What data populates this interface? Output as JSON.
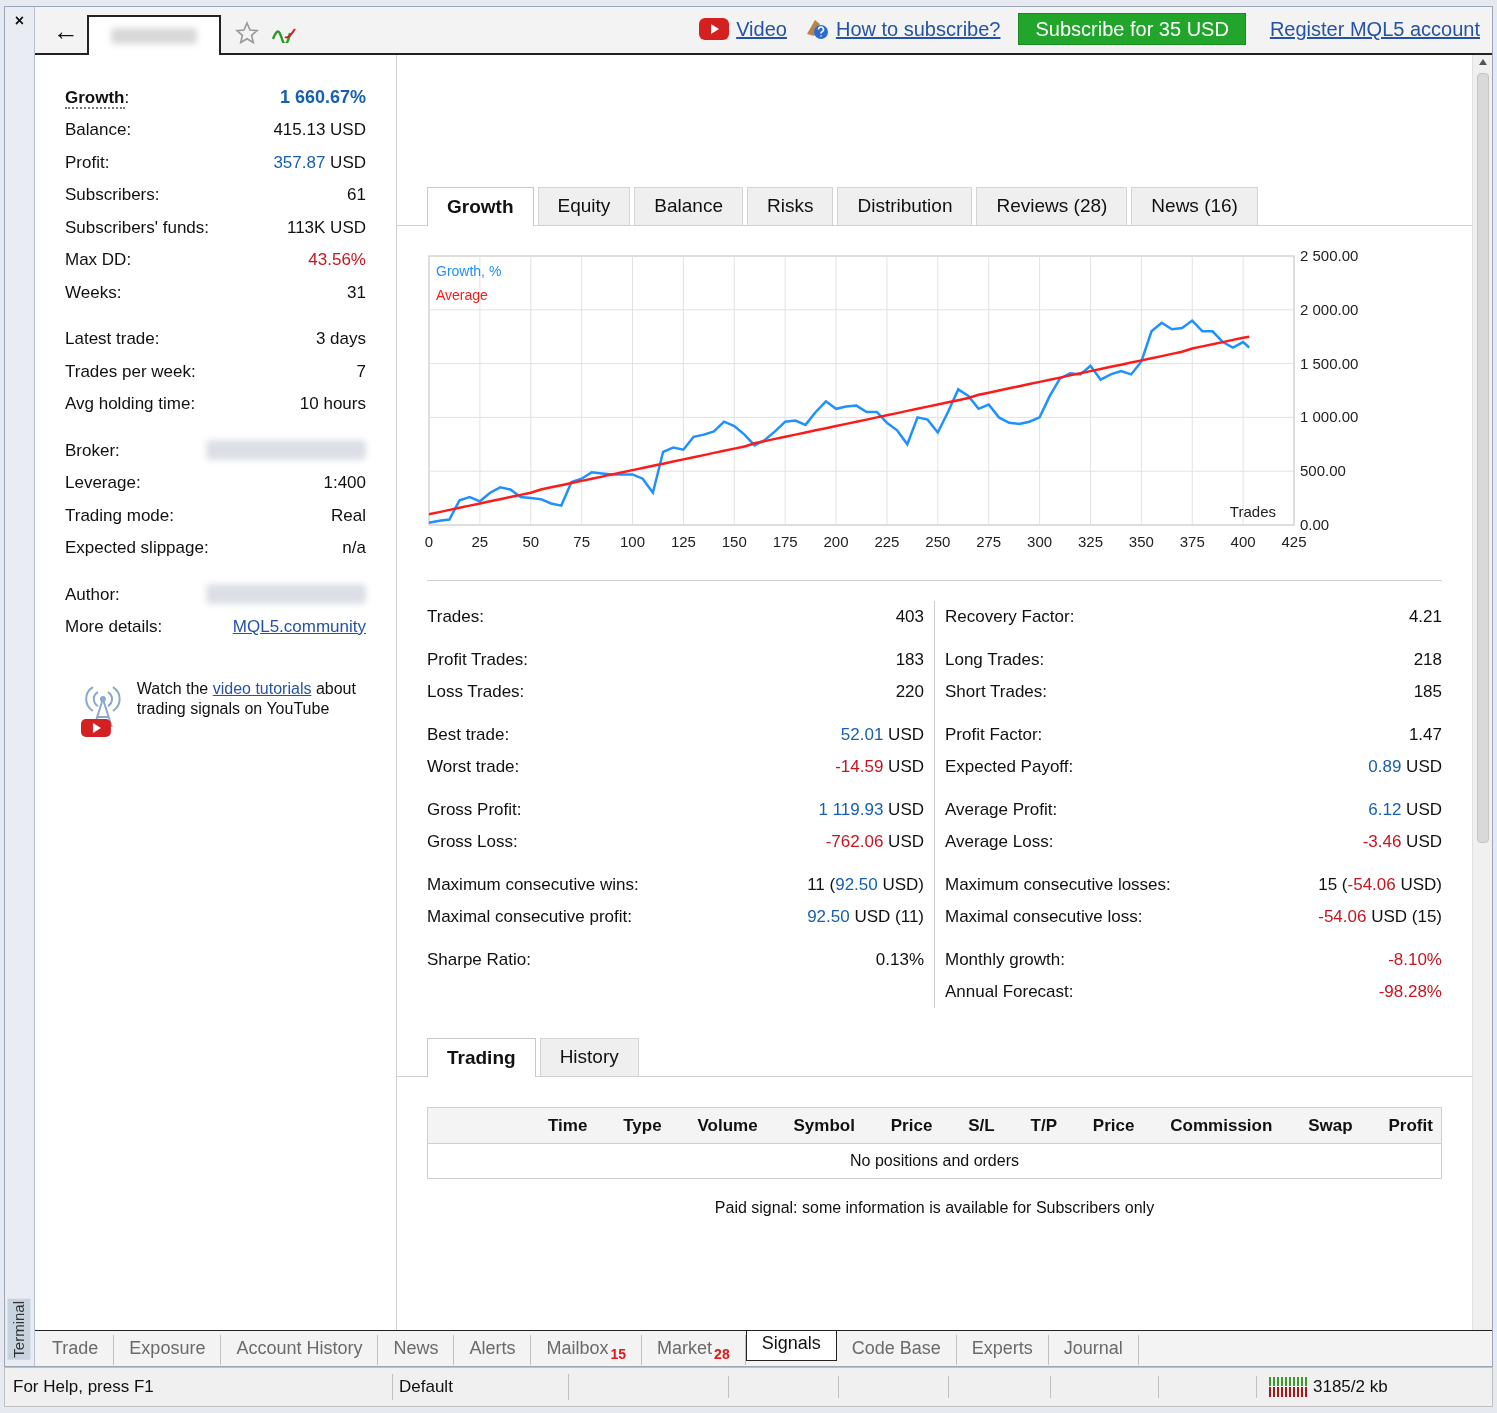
{
  "window": {
    "close_label": "×",
    "side_label": "Terminal"
  },
  "toolbar": {
    "back_label": "←",
    "links": [
      {
        "kind": "video",
        "label": "Video"
      },
      {
        "kind": "help",
        "label": "How to subscribe?"
      }
    ],
    "subscribe_button": "Subscribe for 35 USD",
    "register_link": "Register MQL5 account"
  },
  "summary": {
    "sections": [
      {
        "rows": [
          {
            "kind": "headline",
            "label": "**Growth**:",
            "value": [
              {
                "text": "1 660.67%",
                "color": "#1560b0"
              }
            ]
          },
          {
            "kind": "plain",
            "label": "Balance:",
            "value": [
              {
                "text": "415.13 USD"
              }
            ]
          },
          {
            "kind": "plain",
            "label": "Profit:",
            "value": [
              {
                "text": "357.87",
                "color": "#1560b0"
              },
              {
                "text": " USD"
              }
            ]
          },
          {
            "kind": "plain",
            "label": "Subscribers:",
            "value": [
              {
                "text": "61"
              }
            ]
          },
          {
            "kind": "plain",
            "label": "Subscribers' funds:",
            "value": [
              {
                "text": "113K USD"
              }
            ]
          },
          {
            "kind": "plain",
            "label": "Max DD:",
            "value": [
              {
                "text": "43.56%",
                "color": "#c8141e"
              }
            ]
          },
          {
            "kind": "plain",
            "label": "Weeks:",
            "value": [
              {
                "text": "31"
              }
            ]
          }
        ]
      },
      {
        "rows": [
          {
            "kind": "plain",
            "label": "Latest trade:",
            "value": [
              {
                "text": "3 days"
              }
            ]
          },
          {
            "kind": "plain",
            "label": "Trades per week:",
            "value": [
              {
                "text": "7"
              }
            ]
          },
          {
            "kind": "plain",
            "label": "Avg holding time:",
            "value": [
              {
                "text": "10 hours"
              }
            ]
          }
        ]
      },
      {
        "rows": [
          {
            "kind": "blurred",
            "label": "Broker:"
          },
          {
            "kind": "plain",
            "label": "Leverage:",
            "value": [
              {
                "text": "1:400"
              }
            ]
          },
          {
            "kind": "plain",
            "label": "Trading mode:",
            "value": [
              {
                "text": "Real"
              }
            ]
          },
          {
            "kind": "plain",
            "label": "Expected slippage:",
            "value": [
              {
                "text": "n/a"
              }
            ]
          }
        ]
      },
      {
        "rows": [
          {
            "kind": "blurred",
            "label": "Author:"
          },
          {
            "kind": "link",
            "label": "More details:",
            "value": [
              {
                "text": "MQL5.community"
              }
            ]
          }
        ]
      }
    ],
    "promo": {
      "before": "Watch the ",
      "link": "video tutorials",
      "after": " about trading signals on YouTube"
    }
  },
  "chart_tabs": [
    {
      "label": "Growth",
      "selected": true
    },
    {
      "label": "Equity",
      "selected": false
    },
    {
      "label": "Balance",
      "selected": false
    },
    {
      "label": "Risks",
      "selected": false
    },
    {
      "label": "Distribution",
      "selected": false
    },
    {
      "label": "Reviews (28)",
      "selected": false
    },
    {
      "label": "News (16)",
      "selected": false
    }
  ],
  "growth_chart": {
    "chart_data": {
      "type": "line",
      "xlabel": "Trades",
      "grid": true,
      "xlim": [
        0,
        425
      ],
      "ylim": [
        0,
        2500
      ],
      "xticks": [
        0,
        25,
        50,
        75,
        100,
        125,
        150,
        175,
        200,
        225,
        250,
        275,
        300,
        325,
        350,
        375,
        400,
        425
      ],
      "yticks": [
        {
          "value": 0,
          "label": "0.00"
        },
        {
          "value": 500,
          "label": "500.00"
        },
        {
          "value": 1000,
          "label": "1 000.00"
        },
        {
          "value": 1500,
          "label": "1 500.00"
        },
        {
          "value": 2000,
          "label": "2 000.00"
        },
        {
          "value": 2500,
          "label": "2 500.00"
        }
      ],
      "x": [
        0,
        5,
        10,
        15,
        20,
        25,
        30,
        35,
        40,
        45,
        50,
        55,
        60,
        65,
        70,
        75,
        80,
        85,
        90,
        95,
        100,
        105,
        110,
        115,
        120,
        125,
        130,
        135,
        140,
        145,
        150,
        155,
        160,
        165,
        170,
        175,
        180,
        185,
        190,
        195,
        200,
        205,
        210,
        215,
        220,
        225,
        230,
        235,
        240,
        245,
        250,
        255,
        260,
        265,
        270,
        275,
        280,
        285,
        290,
        295,
        300,
        305,
        310,
        315,
        320,
        325,
        330,
        335,
        340,
        345,
        350,
        355,
        360,
        365,
        370,
        375,
        380,
        385,
        390,
        395,
        400,
        403
      ],
      "series": [
        {
          "name": "Growth, %",
          "color": "#1e90ff",
          "values": [
            20,
            40,
            50,
            230,
            260,
            220,
            300,
            350,
            330,
            260,
            250,
            240,
            200,
            180,
            400,
            430,
            490,
            480,
            470,
            470,
            470,
            430,
            300,
            680,
            720,
            700,
            820,
            840,
            870,
            960,
            920,
            840,
            740,
            790,
            870,
            960,
            970,
            930,
            1050,
            1150,
            1080,
            1100,
            1110,
            1050,
            1050,
            950,
            880,
            750,
            1000,
            980,
            860,
            1050,
            1260,
            1200,
            1080,
            1120,
            1000,
            950,
            940,
            960,
            1000,
            1200,
            1360,
            1410,
            1400,
            1480,
            1350,
            1400,
            1430,
            1400,
            1520,
            1800,
            1880,
            1820,
            1830,
            1900,
            1800,
            1800,
            1700,
            1650,
            1700,
            1650
          ]
        },
        {
          "name": "Average",
          "color": "#ff1a1a",
          "values": [
            100,
            120,
            140,
            160,
            180,
            200,
            220,
            240,
            260,
            280,
            300,
            330,
            350,
            370,
            390,
            410,
            430,
            450,
            470,
            490,
            510,
            530,
            550,
            570,
            590,
            610,
            630,
            650,
            670,
            690,
            710,
            730,
            760,
            780,
            800,
            820,
            840,
            860,
            880,
            900,
            920,
            940,
            960,
            980,
            1000,
            1020,
            1040,
            1060,
            1080,
            1100,
            1120,
            1140,
            1160,
            1180,
            1210,
            1230,
            1250,
            1270,
            1290,
            1310,
            1330,
            1350,
            1370,
            1390,
            1410,
            1430,
            1450,
            1470,
            1490,
            1510,
            1530,
            1550,
            1570,
            1590,
            1610,
            1640,
            1660,
            1680,
            1700,
            1720,
            1740,
            1750
          ]
        }
      ]
    }
  },
  "stats": [
    {
      "sections": [
        {
          "rows": [
            {
              "label": "Trades:",
              "value": [
                {
                  "text": "403"
                }
              ]
            }
          ]
        },
        {
          "rows": [
            {
              "label": "Profit Trades:",
              "value": [
                {
                  "text": "183"
                }
              ]
            },
            {
              "label": "Loss Trades:",
              "value": [
                {
                  "text": "220"
                }
              ]
            }
          ]
        },
        {
          "rows": [
            {
              "label": "Best trade:",
              "value": [
                {
                  "text": "52.01",
                  "color": "#1560b0"
                },
                {
                  "text": " USD"
                }
              ]
            },
            {
              "label": "Worst trade:",
              "value": [
                {
                  "text": "-14.59",
                  "color": "#c8141e"
                },
                {
                  "text": " USD"
                }
              ]
            }
          ]
        },
        {
          "rows": [
            {
              "label": "Gross Profit:",
              "value": [
                {
                  "text": "1 119.93",
                  "color": "#1560b0"
                },
                {
                  "text": " USD"
                }
              ]
            },
            {
              "label": "Gross Loss:",
              "value": [
                {
                  "text": "-762.06",
                  "color": "#c8141e"
                },
                {
                  "text": " USD"
                }
              ]
            }
          ]
        },
        {
          "rows": [
            {
              "label": "Maximum consecutive wins:",
              "value": [
                {
                  "text": "11 ("
                },
                {
                  "text": "92.50",
                  "color": "#1560b0"
                },
                {
                  "text": " USD)"
                }
              ]
            },
            {
              "label": "Maximal consecutive profit:",
              "value": [
                {
                  "text": "92.50",
                  "color": "#1560b0"
                },
                {
                  "text": " USD (11)"
                }
              ]
            }
          ]
        },
        {
          "rows": [
            {
              "label": "Sharpe Ratio:",
              "value": [
                {
                  "text": "0.13%"
                }
              ]
            }
          ]
        }
      ]
    },
    {
      "sections": [
        {
          "rows": [
            {
              "label": "Recovery Factor:",
              "value": [
                {
                  "text": "4.21"
                }
              ]
            }
          ]
        },
        {
          "rows": [
            {
              "label": "Long Trades:",
              "value": [
                {
                  "text": "218"
                }
              ]
            },
            {
              "label": "Short Trades:",
              "value": [
                {
                  "text": "185"
                }
              ]
            }
          ]
        },
        {
          "rows": [
            {
              "label": "Profit Factor:",
              "value": [
                {
                  "text": "1.47"
                }
              ]
            },
            {
              "label": "Expected Payoff:",
              "value": [
                {
                  "text": "0.89",
                  "color": "#1560b0"
                },
                {
                  "text": " USD"
                }
              ]
            }
          ]
        },
        {
          "rows": [
            {
              "label": "Average Profit:",
              "value": [
                {
                  "text": "6.12",
                  "color": "#1560b0"
                },
                {
                  "text": " USD"
                }
              ]
            },
            {
              "label": "Average Loss:",
              "value": [
                {
                  "text": "-3.46",
                  "color": "#c8141e"
                },
                {
                  "text": " USD"
                }
              ]
            }
          ]
        },
        {
          "rows": [
            {
              "label": "Maximum consecutive losses:",
              "value": [
                {
                  "text": "15 ("
                },
                {
                  "text": "-54.06",
                  "color": "#c8141e"
                },
                {
                  "text": " USD)"
                }
              ]
            },
            {
              "label": "Maximal consecutive loss:",
              "value": [
                {
                  "text": "-54.06",
                  "color": "#c8141e"
                },
                {
                  "text": " USD (15)"
                }
              ]
            }
          ]
        },
        {
          "rows": [
            {
              "label": "Monthly growth:",
              "value": [
                {
                  "text": "-8.10%",
                  "color": "#c8141e"
                }
              ]
            },
            {
              "label": "Annual Forecast:",
              "value": [
                {
                  "text": "-98.28%",
                  "color": "#c8141e"
                }
              ]
            }
          ]
        }
      ]
    }
  ],
  "trade_tabs": [
    {
      "label": "Trading",
      "selected": true
    },
    {
      "label": "History",
      "selected": false
    }
  ],
  "trade_table": {
    "columns": [
      "Time",
      "Type",
      "Volume",
      "Symbol",
      "Price",
      "S/L",
      "T/P",
      "Price",
      "Commission",
      "Swap",
      "Profit"
    ],
    "empty_message": "No positions and orders"
  },
  "note": "Paid signal: some information is available for Subscribers only",
  "terminal_tabs": [
    {
      "label": "Trade",
      "selected": false
    },
    {
      "label": "Exposure",
      "selected": false
    },
    {
      "label": "Account History",
      "selected": false
    },
    {
      "label": "News",
      "selected": false
    },
    {
      "label": "Alerts",
      "selected": false
    },
    {
      "label": "Mailbox",
      "badge": "15",
      "selected": false
    },
    {
      "label": "Market",
      "badge": "28",
      "selected": false
    },
    {
      "label": "Signals",
      "selected": true
    },
    {
      "label": "Code Base",
      "selected": false
    },
    {
      "label": "Experts",
      "selected": false
    },
    {
      "label": "Journal",
      "selected": false
    }
  ],
  "status_bar": {
    "help": "For Help, press F1",
    "profile": "Default",
    "memory": "3185/2 kb"
  }
}
